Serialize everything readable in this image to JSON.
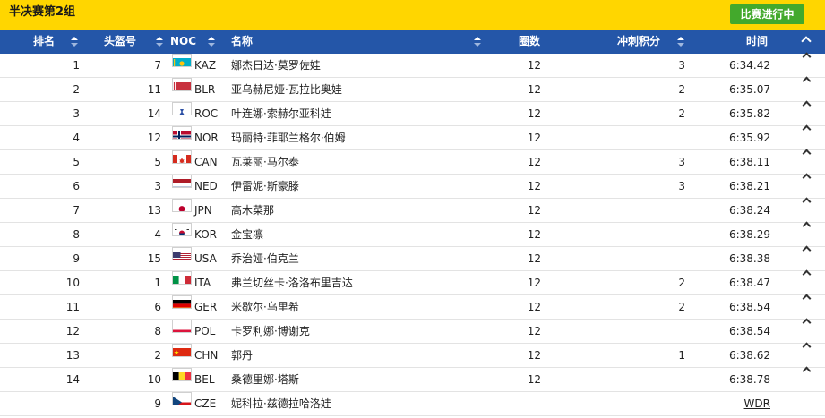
{
  "header": {
    "title": "半决赛第2组",
    "status_button": "比赛进行中"
  },
  "columns": {
    "rank": "排名",
    "bib": "头盔号",
    "noc": "NOC",
    "name": "名称",
    "laps": "圈数",
    "sprint_points": "冲刺积分",
    "time": "时间"
  },
  "colors": {
    "topbar": "#ffd600",
    "header": "#2456a8",
    "live_button": "#43a92c"
  },
  "rows": [
    {
      "rank": "1",
      "bib": "7",
      "noc": "KAZ",
      "flag": "kaz-flag",
      "name": "娜杰日达·莫罗佐娃",
      "laps": "12",
      "points": "3",
      "time": "6:34.42"
    },
    {
      "rank": "2",
      "bib": "11",
      "noc": "BLR",
      "flag": "blr-flag",
      "name": "亚乌赫尼娅·瓦拉比奥娃",
      "laps": "12",
      "points": "2",
      "time": "6:35.07"
    },
    {
      "rank": "3",
      "bib": "14",
      "noc": "ROC",
      "flag": "roc-flag",
      "name": "叶连娜·索赫尔亚科娃",
      "laps": "12",
      "points": "2",
      "time": "6:35.82"
    },
    {
      "rank": "4",
      "bib": "12",
      "noc": "NOR",
      "flag": "nor-flag",
      "name": "玛丽特·菲耶兰格尔·伯姆",
      "laps": "12",
      "points": "",
      "time": "6:35.92"
    },
    {
      "rank": "5",
      "bib": "5",
      "noc": "CAN",
      "flag": "can-flag",
      "name": "瓦莱丽·马尔泰",
      "laps": "12",
      "points": "3",
      "time": "6:38.11"
    },
    {
      "rank": "6",
      "bib": "3",
      "noc": "NED",
      "flag": "ned-flag",
      "name": "伊雷妮·斯豪滕",
      "laps": "12",
      "points": "3",
      "time": "6:38.21"
    },
    {
      "rank": "7",
      "bib": "13",
      "noc": "JPN",
      "flag": "jpn-flag",
      "name": "高木菜那",
      "laps": "12",
      "points": "",
      "time": "6:38.24"
    },
    {
      "rank": "8",
      "bib": "4",
      "noc": "KOR",
      "flag": "kor-flag",
      "name": "金宝凛",
      "laps": "12",
      "points": "",
      "time": "6:38.29"
    },
    {
      "rank": "9",
      "bib": "15",
      "noc": "USA",
      "flag": "usa-flag",
      "name": "乔治娅·伯克兰",
      "laps": "12",
      "points": "",
      "time": "6:38.38"
    },
    {
      "rank": "10",
      "bib": "1",
      "noc": "ITA",
      "flag": "ita-flag",
      "name": "弗兰切丝卡·洛洛布里吉达",
      "laps": "12",
      "points": "2",
      "time": "6:38.47"
    },
    {
      "rank": "11",
      "bib": "6",
      "noc": "GER",
      "flag": "ger-flag",
      "name": "米歇尔·乌里希",
      "laps": "12",
      "points": "2",
      "time": "6:38.54"
    },
    {
      "rank": "12",
      "bib": "8",
      "noc": "POL",
      "flag": "pol-flag",
      "name": "卡罗利娜·博谢克",
      "laps": "12",
      "points": "",
      "time": "6:38.54"
    },
    {
      "rank": "13",
      "bib": "2",
      "noc": "CHN",
      "flag": "chn-flag",
      "name": "郭丹",
      "laps": "12",
      "points": "1",
      "time": "6:38.62"
    },
    {
      "rank": "14",
      "bib": "10",
      "noc": "BEL",
      "flag": "bel-flag",
      "name": "桑德里娜·塔斯",
      "laps": "12",
      "points": "",
      "time": "6:38.78"
    },
    {
      "rank": "",
      "bib": "9",
      "noc": "CZE",
      "flag": "cze-flag",
      "name": "妮科拉·兹德拉哈洛娃",
      "laps": "",
      "points": "",
      "time": "WDR"
    }
  ]
}
